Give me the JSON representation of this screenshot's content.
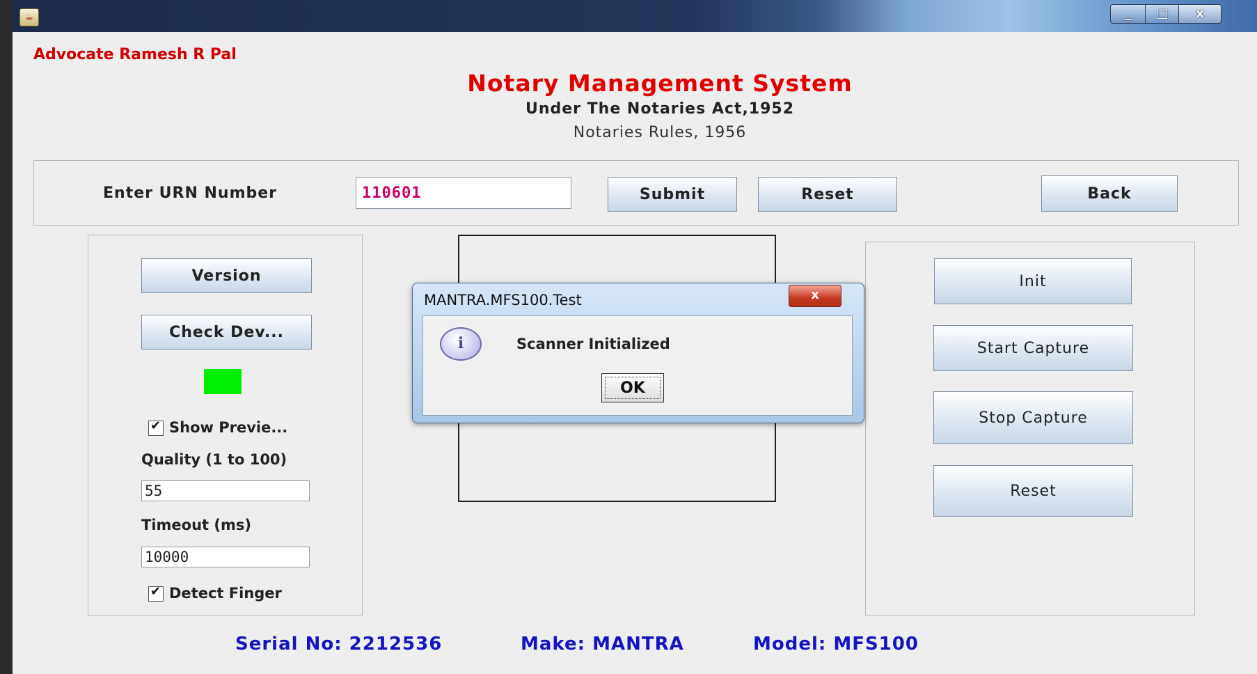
{
  "window": {
    "close_symbol": "x"
  },
  "header": {
    "advocate": "Advocate Ramesh R Pal",
    "title": "Notary Management System",
    "subtitle": "Under The Notaries Act,1952",
    "rules": "Notaries Rules, 1956"
  },
  "urn": {
    "label": "Enter URN Number",
    "value": "110601",
    "submit_label": "Submit",
    "reset_label": "Reset",
    "back_label": "Back"
  },
  "device_panel": {
    "version_label": "Version",
    "check_device_label": "Check Dev...",
    "show_preview_label": "Show Previe...",
    "show_preview_checked": true,
    "quality_label": "Quality (1 to 100)",
    "quality_value": "55",
    "timeout_label": "Timeout (ms)",
    "timeout_value": "10000",
    "detect_finger_label": "Detect Finger",
    "detect_finger_checked": true,
    "status_color": "#00ee00"
  },
  "capture_panel": {
    "init_label": "Init",
    "start_label": "Start Capture",
    "stop_label": "Stop Capture",
    "reset_label": "Reset"
  },
  "footer": {
    "serial": "Serial No: 2212536",
    "make": "Make: MANTRA",
    "model": "Model: MFS100"
  },
  "dialog": {
    "title": "MANTRA.MFS100.Test",
    "message": "Scanner Initialized",
    "ok_label": "OK",
    "close_symbol": "x",
    "icon": "info-icon"
  }
}
